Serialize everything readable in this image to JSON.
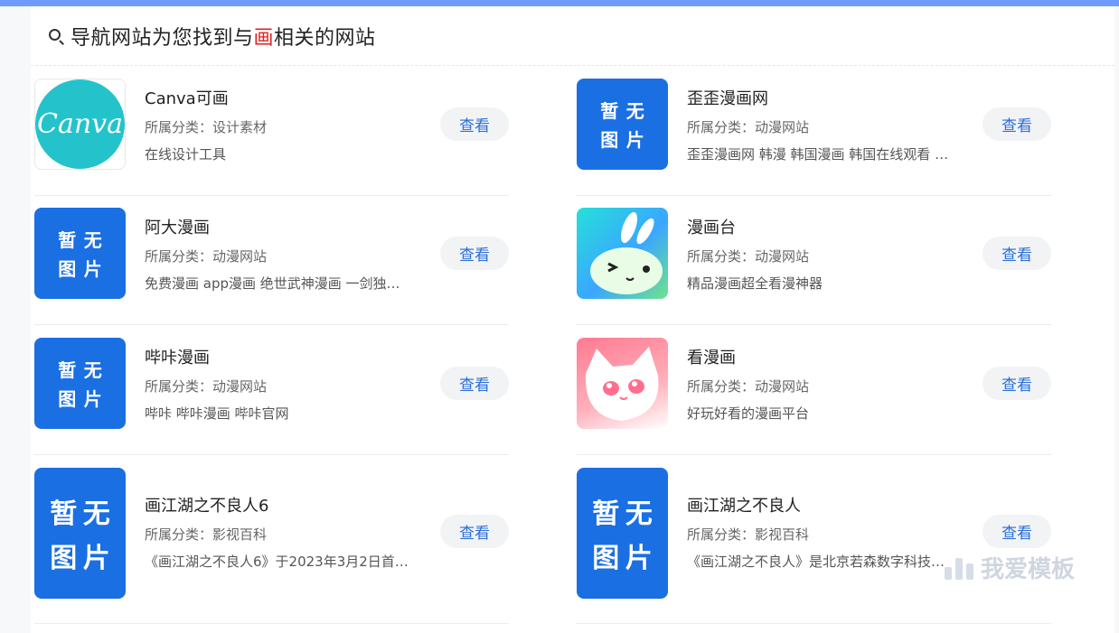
{
  "header": {
    "prefix": "导航网站为您找到与",
    "keyword": "画",
    "suffix": "相关的网站"
  },
  "placeholder_text": [
    "暂",
    "无",
    "图",
    "片"
  ],
  "canva_logo_text": "Canva",
  "view_label": "查看",
  "sites": [
    {
      "title": "Canva可画",
      "category": "所属分类：设计素材",
      "desc": "在线设计工具"
    },
    {
      "title": "歪歪漫画网",
      "category": "所属分类：动漫网站",
      "desc": "歪歪漫画网 韩漫 韩国漫画 韩国在线观看 …"
    },
    {
      "title": "阿大漫画",
      "category": "所属分类：动漫网站",
      "desc": "免费漫画 app漫画 绝世武神漫画 一剑独…"
    },
    {
      "title": "漫画台",
      "category": "所属分类：动漫网站",
      "desc": "精品漫画超全看漫神器"
    },
    {
      "title": "哔咔漫画",
      "category": "所属分类：动漫网站",
      "desc": "哔咔 哔咔漫画 哔咔官网"
    },
    {
      "title": "看漫画",
      "category": "所属分类：动漫网站",
      "desc": "好玩好看的漫画平台"
    },
    {
      "title": "画江湖之不良人6",
      "category": "所属分类：影视百科",
      "desc": "《画江湖之不良人6》于2023年3月2日首…"
    },
    {
      "title": "画江湖之不良人",
      "category": "所属分类：影视百科",
      "desc": "《画江湖之不良人》是北京若森数字科技…"
    }
  ],
  "watermark": "我爱模板",
  "colors": {
    "accent": "#6e9bff",
    "link": "#2a6fd8",
    "placeholder_bg": "#1a6fe3",
    "keyword": "#e02020"
  }
}
